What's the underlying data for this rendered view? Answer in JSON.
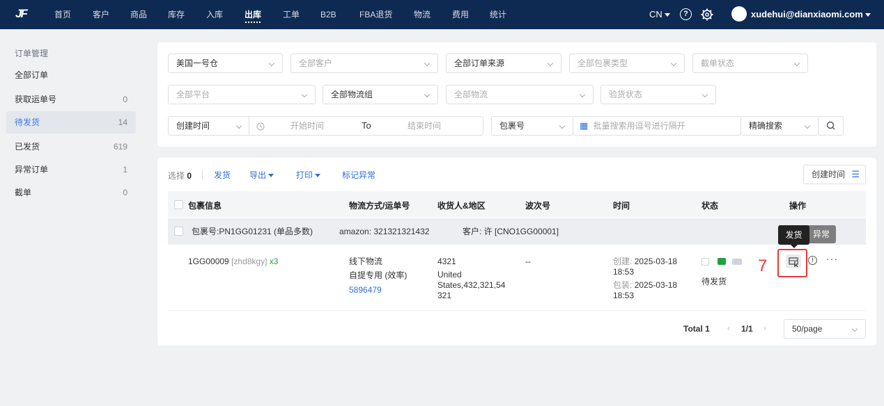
{
  "nav": {
    "logo": "JF",
    "items": [
      "首页",
      "客户",
      "商品",
      "库存",
      "入库",
      "出库",
      "工单",
      "B2B",
      "FBA退货",
      "物流",
      "费用",
      "统计"
    ],
    "lang": "CN",
    "help_icon": "question-circle-icon",
    "settings_icon": "gear-icon",
    "user": "xudehui@dianxiaomi.com"
  },
  "sidebar": {
    "title": "订单管理",
    "items": [
      {
        "label": "全部订单",
        "count": ""
      },
      {
        "label": "获取运单号",
        "count": "0"
      },
      {
        "label": "待发货",
        "count": "14"
      },
      {
        "label": "已发货",
        "count": "619"
      },
      {
        "label": "异常订单",
        "count": "1"
      },
      {
        "label": "截单",
        "count": "0"
      }
    ]
  },
  "filters": {
    "warehouse": "美国一号仓",
    "customer": "全部客户",
    "order_source": "全部订单来源",
    "package_type": "全部包裹类型",
    "cutoff_status": "截单状态",
    "platform": "全部平台",
    "logistics_group": "全部物流组",
    "logistics": "全部物流",
    "inspection_status": "验货状态",
    "time_type": "创建时间",
    "start_time": "开始时间",
    "to": "To",
    "end_time": "结束时间",
    "search_field": "包裹号",
    "search_placeholder": "批量搜索用逗号进行隔开",
    "search_mode": "精确搜索"
  },
  "toolbar": {
    "select_label": "选择",
    "select_count": "0",
    "ship": "发货",
    "export": "导出",
    "print": "打印",
    "mark_abnormal": "标记异常",
    "sort": "创建时间"
  },
  "table": {
    "headers": [
      "包裹信息",
      "物流方式/运单号",
      "收货人&地区",
      "波次号",
      "时间",
      "状态",
      "操作"
    ],
    "group_row": {
      "package": "包裹号:PN1GG01231 (单品多数)",
      "amazon": "amazon: 321321321432",
      "customer": "客户: 许 [CNO1GG00001]"
    },
    "row": {
      "sku": "1GG00009",
      "sku_code": "[zhd8kgy]",
      "qty": "x3",
      "logistics": "线下物流",
      "logistics_sub": "自提专用 (效率)",
      "tracking": "5896479",
      "receiver": "4321",
      "region_1": "United",
      "region_2": "States,432,321,54",
      "region_3": "321",
      "wave": "--",
      "created_label": "创建:",
      "created_date": "2025-03-18",
      "created_time": "18:53",
      "packed_label": "包装:",
      "packed_date": "2025-03-18",
      "packed_time": "18:53",
      "status": "待发货"
    }
  },
  "tooltips": {
    "ship": "发货",
    "abnormal": "异常"
  },
  "annotation": "7",
  "pagination": {
    "total": "Total 1",
    "page": "1/1",
    "page_size": "50/page"
  },
  "colors": {
    "nav_bg": "#0e2a52",
    "accent": "#2f6fd8",
    "highlight": "#e53935",
    "green": "#22a23c"
  }
}
